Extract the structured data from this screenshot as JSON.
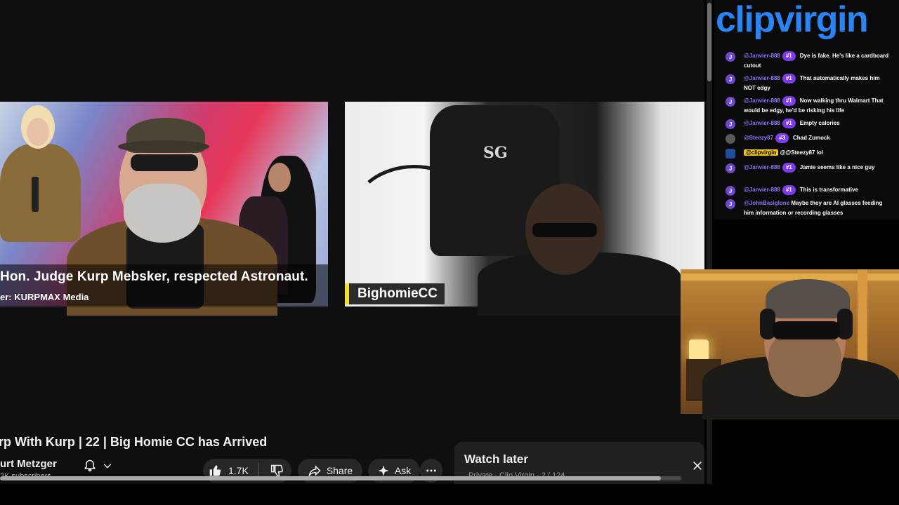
{
  "video": {
    "lower_third_title": "Hon. Judge Kurp Mebsker, respected Astronaut.",
    "lower_third_sub": "er: KURPMAX Media",
    "guest_label": "BighomieCC",
    "shirt_logo": "SG",
    "title": "rp With Kurp | 22 | Big Homie CC has Arrived",
    "progress": 0.97,
    "progress_color": "#aaaaaa"
  },
  "channel": {
    "name": "urt Metzger",
    "subscribers": "2K subscribers"
  },
  "actions": {
    "like_count": "1.7K",
    "share_label": "Share",
    "ask_label": "Ask"
  },
  "watch_later": {
    "title": "Watch later",
    "meta": "Private · Clip Virgin · 2 / 124"
  },
  "chat": {
    "brand": "clipvirgin",
    "accent": "#2b84f4",
    "messages": [
      {
        "avatar": "J",
        "user": "@Janvier-888",
        "badge": "#1",
        "text": "Dye is fake. He's like a cardboard cutout"
      },
      {
        "avatar": "J",
        "user": "@Janvier-888",
        "badge": "#1",
        "text": "That automatically makes him NOT edgy"
      },
      {
        "avatar": "J",
        "user": "@Janvier-888",
        "badge": "#1",
        "text": "Now walking thru Walmart That would be edgy, he'd be risking his life"
      },
      {
        "avatar": "J",
        "user": "@Janvier-888",
        "badge": "#1",
        "text": "Empty calories"
      },
      {
        "avatar": "",
        "user": "@Steezy87",
        "badge": "#3",
        "text": "Chad Zumock"
      },
      {
        "avatar": "cv",
        "user": "@clipvirgin",
        "badge": "",
        "text": "@@Steezy87 lol"
      },
      {
        "avatar": "J",
        "user": "@Janvier-888",
        "badge": "#1",
        "text": "Jamie seems like a nice guy"
      },
      {
        "avatar": "J",
        "user": "@Janvier-888",
        "badge": "#1",
        "text": "This is transformative"
      },
      {
        "avatar": "J",
        "user": "@JohnBasiglone",
        "badge": "",
        "text": "Maybe they are AI glasses feeding him information or recording glasses"
      }
    ]
  },
  "icons": {
    "bell": "bell-icon",
    "chevron": "chevron-down-icon",
    "like": "thumbs-up-icon",
    "dislike": "thumbs-down-icon",
    "share": "share-icon",
    "ask": "sparkle-icon",
    "more": "more-horizontal-icon",
    "close": "close-icon"
  }
}
